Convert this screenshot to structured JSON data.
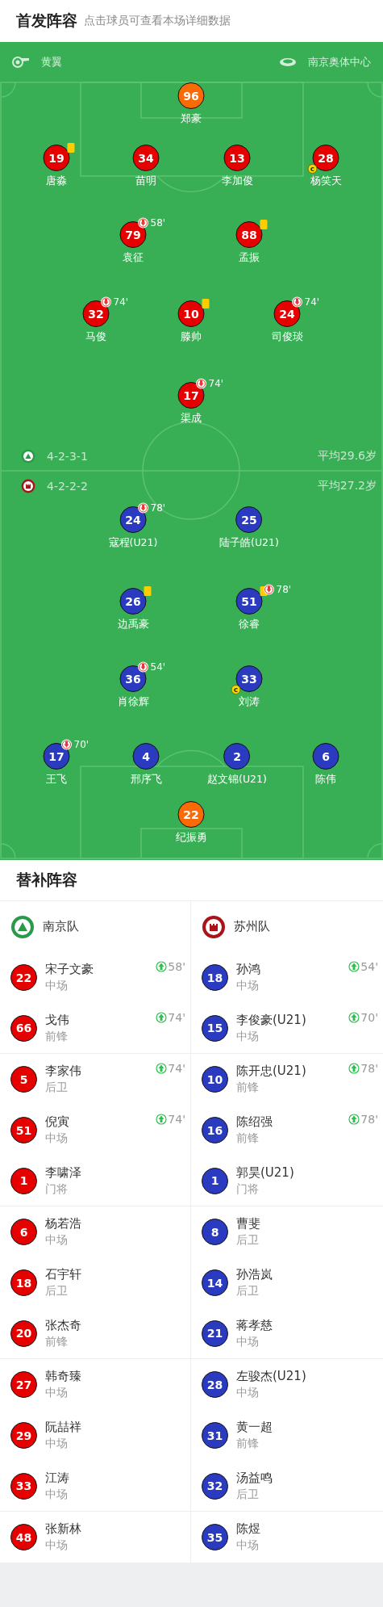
{
  "header": {
    "title": "首发阵容",
    "subtitle": "点击球员可查看本场详细数据"
  },
  "pitch": {
    "referee": "黄翼",
    "stadium": "南京奥体中心",
    "teams": [
      {
        "formation": "4-2-3-1",
        "average_age": "平均29.6岁",
        "captain_badge": "c",
        "lines": [
          [
            {
              "number": "96",
              "name": "郑豪",
              "kind": "goalkeeper",
              "yellow_card": false,
              "captain": false
            }
          ],
          [
            {
              "number": "19",
              "name": "唐淼",
              "kind": "outfield",
              "yellow_card": true,
              "captain": false
            },
            {
              "number": "34",
              "name": "苗明",
              "kind": "outfield",
              "yellow_card": false,
              "captain": false
            },
            {
              "number": "13",
              "name": "李加俊",
              "kind": "outfield",
              "yellow_card": false,
              "captain": false
            },
            {
              "number": "28",
              "name": "杨笑天",
              "kind": "outfield",
              "yellow_card": false,
              "captain": true
            }
          ],
          [
            {
              "number": "79",
              "name": "袁征",
              "kind": "outfield",
              "yellow_card": false,
              "captain": false,
              "subbed_off": "58'"
            },
            {
              "number": "88",
              "name": "孟振",
              "kind": "outfield",
              "yellow_card": true,
              "captain": false
            }
          ],
          [
            {
              "number": "32",
              "name": "马俊",
              "kind": "outfield",
              "yellow_card": false,
              "captain": false,
              "subbed_off": "74'"
            },
            {
              "number": "10",
              "name": "滕帅",
              "kind": "outfield",
              "yellow_card": true,
              "captain": false
            },
            {
              "number": "24",
              "name": "司俊琰",
              "kind": "outfield",
              "yellow_card": false,
              "captain": false,
              "subbed_off": "74'"
            }
          ],
          [
            {
              "number": "17",
              "name": "渠成",
              "kind": "outfield",
              "yellow_card": false,
              "captain": false,
              "subbed_off": "74'"
            }
          ]
        ]
      },
      {
        "formation": "4-2-2-2",
        "average_age": "平均27.2岁",
        "captain_badge": "c",
        "lines": [
          [
            {
              "number": "24",
              "name": "寇程(U21)",
              "kind": "outfield",
              "yellow_card": false,
              "captain": false,
              "subbed_off": "78'"
            },
            {
              "number": "25",
              "name": "陆子皓(U21)",
              "kind": "outfield",
              "yellow_card": false,
              "captain": false
            }
          ],
          [
            {
              "number": "26",
              "name": "边禹豪",
              "kind": "outfield",
              "yellow_card": true,
              "captain": false
            },
            {
              "number": "51",
              "name": "徐睿",
              "kind": "outfield",
              "yellow_card": true,
              "captain": false,
              "subbed_off": "78'"
            }
          ],
          [
            {
              "number": "36",
              "name": "肖徐辉",
              "kind": "outfield",
              "yellow_card": false,
              "captain": false,
              "subbed_off": "54'"
            },
            {
              "number": "33",
              "name": "刘涛",
              "kind": "outfield",
              "yellow_card": false,
              "captain": true
            }
          ],
          [
            {
              "number": "17",
              "name": "王飞",
              "kind": "outfield",
              "yellow_card": false,
              "captain": false,
              "subbed_off": "70'"
            },
            {
              "number": "4",
              "name": "邢序飞",
              "kind": "outfield",
              "yellow_card": false,
              "captain": false
            },
            {
              "number": "2",
              "name": "赵文锦(U21)",
              "kind": "outfield",
              "yellow_card": false,
              "captain": false
            },
            {
              "number": "6",
              "name": "陈伟",
              "kind": "outfield",
              "yellow_card": false,
              "captain": false
            }
          ],
          [
            {
              "number": "22",
              "name": "纪振勇",
              "kind": "goalkeeper",
              "yellow_card": false,
              "captain": false
            }
          ]
        ]
      }
    ]
  },
  "subs": {
    "title": "替补阵容",
    "teams": [
      {
        "name": "南京队",
        "players": [
          {
            "number": "22",
            "name": "宋子文豪",
            "position": "中场",
            "subbed_on": "58'"
          },
          {
            "number": "66",
            "name": "戈伟",
            "position": "前锋",
            "subbed_on": "74'"
          },
          {
            "number": "5",
            "name": "李家伟",
            "position": "后卫",
            "subbed_on": "74'"
          },
          {
            "number": "51",
            "name": "倪寅",
            "position": "中场",
            "subbed_on": "74'"
          },
          {
            "number": "1",
            "name": "李啸泽",
            "position": "门将"
          },
          {
            "number": "6",
            "name": "杨若浩",
            "position": "中场"
          },
          {
            "number": "18",
            "name": "石宇轩",
            "position": "后卫"
          },
          {
            "number": "20",
            "name": "张杰奇",
            "position": "前锋"
          },
          {
            "number": "27",
            "name": "韩奇臻",
            "position": "中场"
          },
          {
            "number": "29",
            "name": "阮喆祥",
            "position": "中场"
          },
          {
            "number": "33",
            "name": "江涛",
            "position": "中场"
          },
          {
            "number": "48",
            "name": "张新林",
            "position": "中场"
          }
        ]
      },
      {
        "name": "苏州队",
        "players": [
          {
            "number": "18",
            "name": "孙鸿",
            "position": "中场",
            "subbed_on": "54'"
          },
          {
            "number": "15",
            "name": "李俊豪(U21)",
            "position": "中场",
            "subbed_on": "70'"
          },
          {
            "number": "10",
            "name": "陈开忠(U21)",
            "position": "前锋",
            "subbed_on": "78'"
          },
          {
            "number": "16",
            "name": "陈绍强",
            "position": "前锋",
            "subbed_on": "78'"
          },
          {
            "number": "1",
            "name": "郭昊(U21)",
            "position": "门将"
          },
          {
            "number": "8",
            "name": "曹斐",
            "position": "后卫"
          },
          {
            "number": "14",
            "name": "孙浩岚",
            "position": "后卫"
          },
          {
            "number": "21",
            "name": "蒋孝慈",
            "position": "中场"
          },
          {
            "number": "28",
            "name": "左骏杰(U21)",
            "position": "中场"
          },
          {
            "number": "31",
            "name": "黄一超",
            "position": "前锋"
          },
          {
            "number": "32",
            "name": "汤益鸣",
            "position": "后卫"
          },
          {
            "number": "35",
            "name": "陈煜",
            "position": "中场"
          }
        ]
      }
    ]
  }
}
